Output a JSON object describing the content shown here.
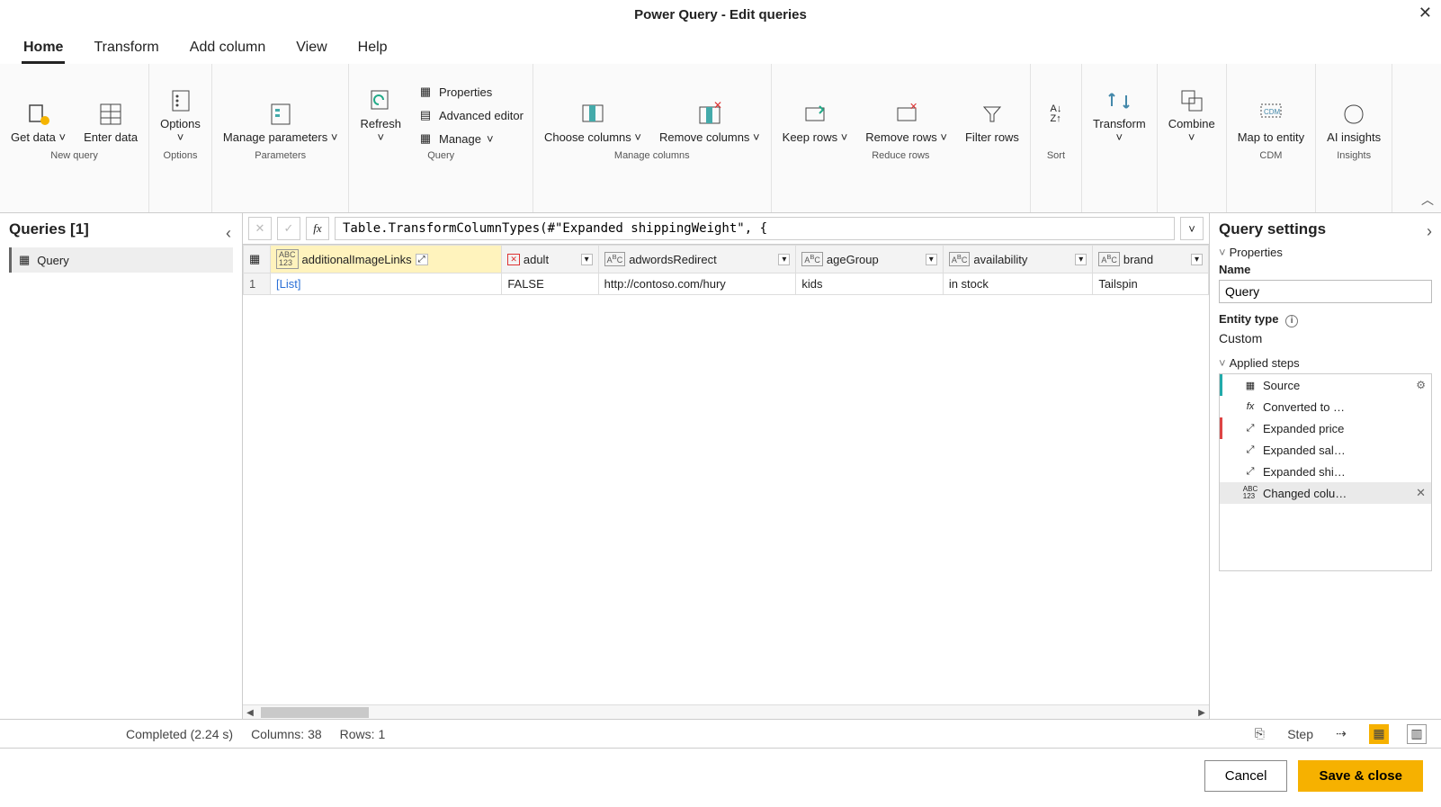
{
  "window": {
    "title": "Power Query - Edit queries"
  },
  "tabs": [
    "Home",
    "Transform",
    "Add column",
    "View",
    "Help"
  ],
  "activeTab": "Home",
  "ribbon": {
    "newQuery": {
      "label": "New query",
      "getData": "Get data",
      "enterData": "Enter data"
    },
    "options": {
      "label": "Options",
      "options": "Options"
    },
    "parameters": {
      "label": "Parameters",
      "manage": "Manage parameters"
    },
    "query": {
      "label": "Query",
      "refresh": "Refresh",
      "properties": "Properties",
      "advanced": "Advanced editor",
      "manage": "Manage"
    },
    "manageCols": {
      "label": "Manage columns",
      "choose": "Choose columns",
      "remove": "Remove columns"
    },
    "reduce": {
      "label": "Reduce rows",
      "keep": "Keep rows",
      "removeRows": "Remove rows",
      "filter": "Filter rows"
    },
    "sort": {
      "label": "Sort"
    },
    "transform": {
      "label": "Transform"
    },
    "combine": {
      "label": "Combine"
    },
    "cdm": {
      "label": "CDM",
      "map": "Map to entity"
    },
    "insights": {
      "label": "Insights",
      "ai": "AI insights"
    }
  },
  "queriesPane": {
    "title": "Queries [1]",
    "items": [
      "Query"
    ]
  },
  "formula": "Table.TransformColumnTypes(#\"Expanded shippingWeight\", {",
  "columns": [
    {
      "name": "additionalImageLinks",
      "type": "ABC123",
      "selected": true,
      "expandable": true
    },
    {
      "name": "adult",
      "type": "X",
      "expandable": false
    },
    {
      "name": "adwordsRedirect",
      "type": "ABC",
      "expandable": false
    },
    {
      "name": "ageGroup",
      "type": "ABC",
      "expandable": false
    },
    {
      "name": "availability",
      "type": "ABC",
      "expandable": false
    },
    {
      "name": "brand",
      "type": "ABC",
      "expandable": false
    }
  ],
  "rows": [
    {
      "n": 1,
      "cells": [
        "[List]",
        "FALSE",
        "http://contoso.com/hury",
        "kids",
        "in stock",
        "Tailspin"
      ]
    }
  ],
  "settings": {
    "title": "Query settings",
    "propsLabel": "Properties",
    "nameLabel": "Name",
    "nameValue": "Query",
    "entityTypeLabel": "Entity type",
    "entityTypeValue": "Custom",
    "appliedLabel": "Applied steps",
    "steps": [
      {
        "label": "Source",
        "gear": true,
        "mark": "teal"
      },
      {
        "label": "Converted to …",
        "fx": true
      },
      {
        "label": "Expanded price",
        "exp": true,
        "mark": "red"
      },
      {
        "label": "Expanded sal…",
        "exp": true
      },
      {
        "label": "Expanded shi…",
        "exp": true
      },
      {
        "label": "Changed colu…",
        "type": true,
        "selected": true,
        "del": true
      }
    ]
  },
  "status": {
    "completed": "Completed (2.24 s)",
    "columns": "Columns: 38",
    "rows": "Rows: 1",
    "stepLabel": "Step"
  },
  "footer": {
    "cancel": "Cancel",
    "save": "Save & close"
  }
}
